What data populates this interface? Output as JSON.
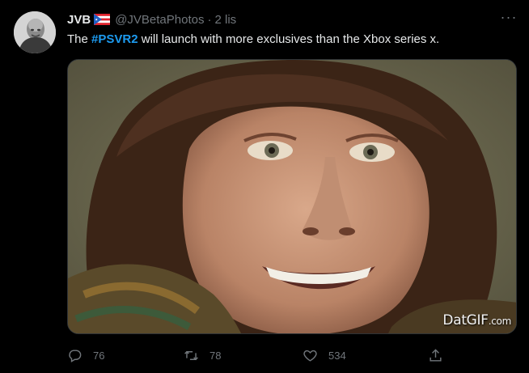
{
  "tweet": {
    "display_name": "JVB",
    "flag_icon": "puerto-rico-flag-icon",
    "handle": "@JVBetaPhotos",
    "separator": "·",
    "time": "2 lis",
    "more_icon": "more-dots-icon",
    "text_before": "The ",
    "hashtag": "#PSVR2",
    "text_after": " will launch with more exclusives than the Xbox series x.",
    "media": {
      "type": "gif",
      "watermark_main": "DatGIF",
      "watermark_suffix": ".com"
    },
    "actions": {
      "reply_count": "76",
      "retweet_count": "78",
      "like_count": "534"
    }
  },
  "colors": {
    "background": "#000000",
    "text": "#e7e9ea",
    "muted": "#71767b",
    "link": "#1d9bf0"
  }
}
